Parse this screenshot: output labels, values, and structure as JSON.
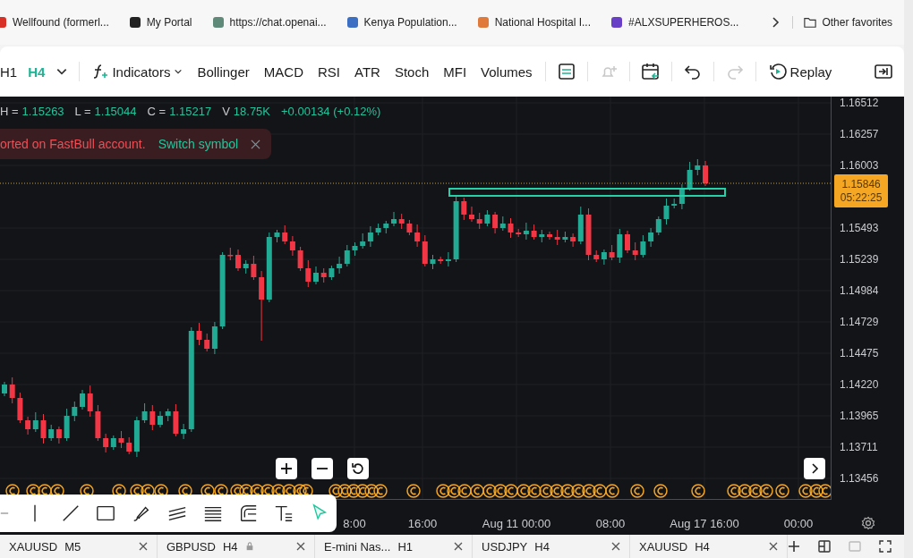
{
  "bookmarks": [
    {
      "label": "Wellfound (formerl..."
    },
    {
      "label": "My Portal"
    },
    {
      "label": "https://chat.openai..."
    },
    {
      "label": "Kenya Population..."
    },
    {
      "label": "National Hospital I..."
    },
    {
      "label": "#ALXSUPERHEROS..."
    }
  ],
  "other_favorites": "Other favorites",
  "toolbar": {
    "timeframes": [
      {
        "label": "H1",
        "selected": false
      },
      {
        "label": "H4",
        "selected": true
      }
    ],
    "indicators_button": "Indicators",
    "indicators": [
      "Bollinger",
      "MACD",
      "RSI",
      "ATR",
      "Stoch",
      "MFI",
      "Volumes"
    ],
    "icon_buttons": [
      {
        "kind": "layout",
        "disabled": false
      },
      {
        "kind": "alert",
        "disabled": true
      },
      {
        "kind": "calendar",
        "disabled": false
      },
      {
        "kind": "undo",
        "disabled": false
      },
      {
        "kind": "redo",
        "disabled": true
      }
    ],
    "replay_button": "Replay"
  },
  "legend": {
    "fields": [
      {
        "label": "H =",
        "value": "1.15263"
      },
      {
        "label": "L =",
        "value": "1.15044"
      },
      {
        "label": "C =",
        "value": "1.15217"
      },
      {
        "label": "V",
        "value": "18.75K"
      }
    ],
    "change": "+0.00134 (+0.12%)"
  },
  "notice": {
    "message": "orted on FastBull account.",
    "action": "Switch symbol"
  },
  "price_axis": {
    "labels": [
      "1.16512",
      "1.16257",
      "1.16003",
      "1.15493",
      "1.15239",
      "1.14984",
      "1.14729",
      "1.14475",
      "1.14220",
      "1.13965",
      "1.13711",
      "1.13456"
    ],
    "current_price": "1.15846",
    "countdown": "05:22:25"
  },
  "time_axis": {
    "labels": [
      "8:00",
      "16:00",
      "Aug 11 00:00",
      "08:00",
      "Aug 17 16:00",
      "00:00"
    ]
  },
  "drawing_tools": [
    {
      "kind": "minus",
      "selected": false
    },
    {
      "kind": "vline",
      "selected": false
    },
    {
      "kind": "line",
      "selected": false
    },
    {
      "kind": "rect",
      "selected": false
    },
    {
      "kind": "brush",
      "selected": false
    },
    {
      "kind": "channel",
      "selected": false
    },
    {
      "kind": "fib",
      "selected": false
    },
    {
      "kind": "curve",
      "selected": false
    },
    {
      "kind": "text",
      "selected": false
    },
    {
      "kind": "cursor",
      "selected": true
    }
  ],
  "symbol_tabs": [
    {
      "symbol": "XAUUSD",
      "timeframe": "M5",
      "locked": false
    },
    {
      "symbol": "GBPUSD",
      "timeframe": "H4",
      "locked": true
    },
    {
      "symbol": "E-mini Nas...",
      "timeframe": "H1",
      "locked": false
    },
    {
      "symbol": "USDJPY",
      "timeframe": "H4",
      "locked": false
    },
    {
      "symbol": "XAUUSD",
      "timeframe": "H4",
      "locked": false
    }
  ]
}
